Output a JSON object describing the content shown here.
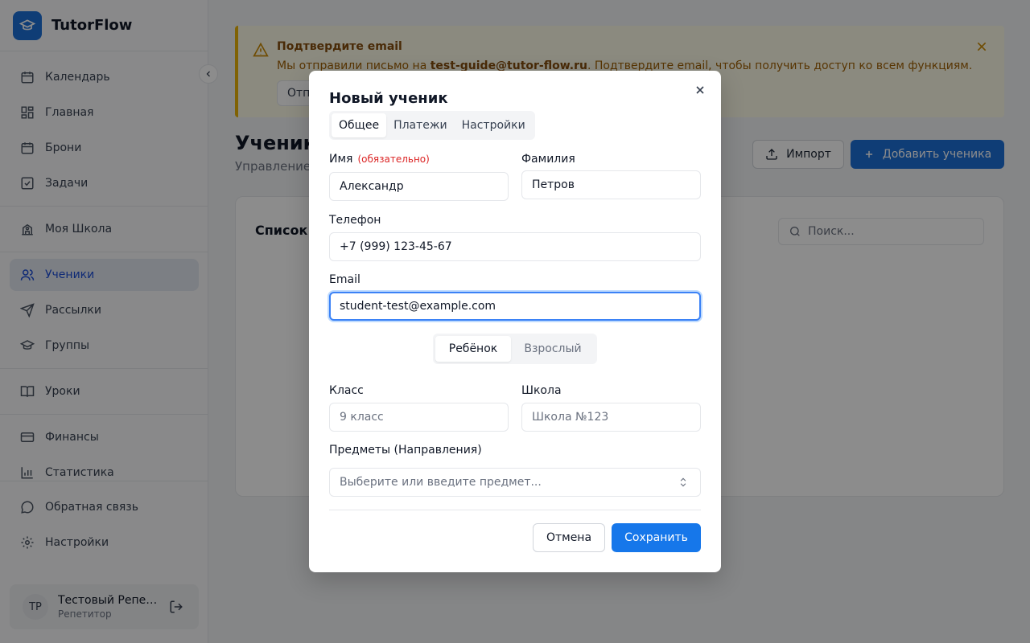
{
  "app": {
    "name": "TutorFlow"
  },
  "sidebar": {
    "items": [
      {
        "label": "Календарь",
        "icon": "calendar-icon"
      },
      {
        "label": "Главная",
        "icon": "dashboard-icon"
      },
      {
        "label": "Брони",
        "icon": "booking-calendar-icon"
      },
      {
        "label": "Задачи",
        "icon": "task-check-icon"
      },
      {
        "label": "Моя Школа",
        "icon": "school-building-icon"
      },
      {
        "label": "Ученики",
        "icon": "users-icon",
        "active": true
      },
      {
        "label": "Рассылки",
        "icon": "send-icon"
      },
      {
        "label": "Группы",
        "icon": "graduation-cap-icon"
      },
      {
        "label": "Уроки",
        "icon": "book-icon"
      },
      {
        "label": "Финансы",
        "icon": "credit-card-icon"
      },
      {
        "label": "Статистика",
        "icon": "bar-chart-icon"
      }
    ],
    "bottom_items": [
      {
        "label": "Обратная связь",
        "icon": "message-icon"
      },
      {
        "label": "Настройки",
        "icon": "gear-icon"
      }
    ],
    "user": {
      "initials": "ТР",
      "name": "Тестовый Репетитор",
      "role": "Репетитор"
    }
  },
  "banner": {
    "title": "Подтвердите email",
    "text_before": "Мы отправили письмо на ",
    "email": "test-guide@tutor-flow.ru",
    "text_after": ". Подтвердите email, чтобы получить доступ ко всем функциям.",
    "button": "Отправить"
  },
  "page": {
    "title": "Ученики",
    "subtitle": "Управление учениками",
    "import_label": "Импорт",
    "add_label": "Добавить ученика",
    "list_title": "Список учеников",
    "search_placeholder": "Поиск..."
  },
  "modal": {
    "title": "Новый ученик",
    "tabs": [
      {
        "label": "Общее",
        "active": true
      },
      {
        "label": "Платежи"
      },
      {
        "label": "Настройки"
      }
    ],
    "first_name": {
      "label": "Имя",
      "required": "(обязательно)",
      "value": "Александр"
    },
    "last_name": {
      "label": "Фамилия",
      "value": "Петров"
    },
    "phone": {
      "label": "Телефон",
      "value": "+7 (999) 123-45-67"
    },
    "email": {
      "label": "Email",
      "value": "student-test@example.com"
    },
    "type_toggle": {
      "child": "Ребёнок",
      "adult": "Взрослый",
      "selected": "Ребёнок"
    },
    "grade": {
      "label": "Класс",
      "placeholder": "9 класс"
    },
    "school": {
      "label": "Школа",
      "placeholder": "Школа №123"
    },
    "subjects": {
      "label": "Предметы (Направления)",
      "placeholder": "Выберите или введите предмет..."
    },
    "cancel": "Отмена",
    "save": "Сохранить"
  },
  "colors": {
    "primary": "#1d6fd8",
    "save": "#1677ea",
    "warning_bg": "#fefce8",
    "warning_border": "#eab308",
    "focus": "#3b82f6",
    "required": "#dc2626"
  }
}
